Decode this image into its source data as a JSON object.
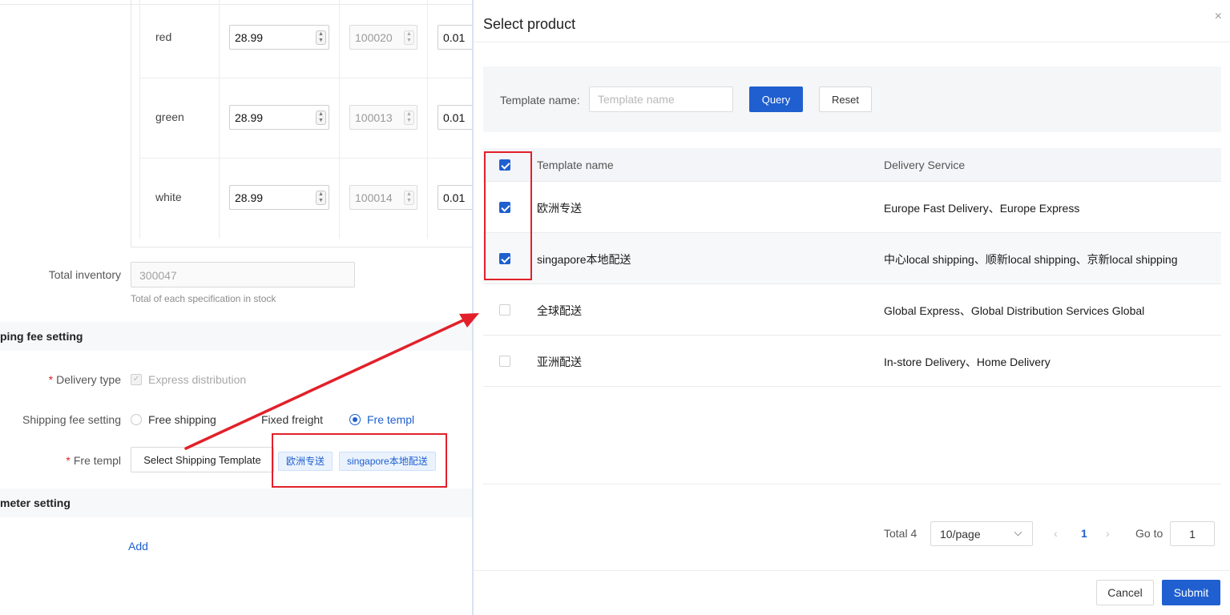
{
  "form": {
    "spec_rows": [
      {
        "color": "red",
        "price": "28.99",
        "stock": "100020",
        "min": "0.01"
      },
      {
        "color": "green",
        "price": "28.99",
        "stock": "100013",
        "min": "0.01"
      },
      {
        "color": "white",
        "price": "28.99",
        "stock": "100014",
        "min": "0.01"
      }
    ],
    "total_inventory_label": "Total inventory",
    "total_inventory_value": "300047",
    "total_inventory_hint": "Total of each specification in stock",
    "shipping_section_title": "ping fee setting",
    "delivery_type_label": "Delivery type",
    "delivery_type_value": "Express distribution",
    "shipping_fee_label": "Shipping fee setting",
    "shipping_options": [
      "Free shipping",
      "Fixed freight",
      "Fre templ"
    ],
    "fre_templ_label": "Fre templ",
    "select_template_button": "Select Shipping Template",
    "selected_tags": [
      "欧洲专送",
      "singapore本地配送"
    ],
    "param_section_title": "meter setting",
    "add_link": "Add",
    "required_mark": "*"
  },
  "drawer": {
    "title": "Select product",
    "close_glyph": "×",
    "filter": {
      "label": "Template name:",
      "placeholder": "Template name",
      "query_button": "Query",
      "reset_button": "Reset"
    },
    "table": {
      "columns": [
        "Template name",
        "Delivery Service"
      ],
      "header_checked": true,
      "rows": [
        {
          "checked": true,
          "name": "欧洲专送",
          "service": "Europe Fast Delivery、Europe Express"
        },
        {
          "checked": true,
          "name": "singapore本地配送",
          "service": "中心local shipping、顺新local shipping、京新local shipping"
        },
        {
          "checked": false,
          "name": "全球配送",
          "service": "Global Express、Global Distribution Services Global"
        },
        {
          "checked": false,
          "name": "亚洲配送",
          "service": "In-store Delivery、Home Delivery"
        }
      ]
    },
    "pagination": {
      "total": "Total 4",
      "page_size": "10/page",
      "prev_glyph": "‹",
      "current_page": "1",
      "next_glyph": "›",
      "goto_label": "Go to",
      "goto_value": "1"
    },
    "footer": {
      "cancel_button": "Cancel",
      "submit_button": "Submit"
    }
  },
  "colors": {
    "primary": "#1f5fcf",
    "annotation_red": "#e2202a"
  },
  "icons": [
    "stepper-icon",
    "checkmark-icon",
    "radio-icon",
    "checkbox-icon",
    "close-icon",
    "chevron-down-icon",
    "chevron-left-icon",
    "chevron-right-icon",
    "arrow-annotation"
  ]
}
